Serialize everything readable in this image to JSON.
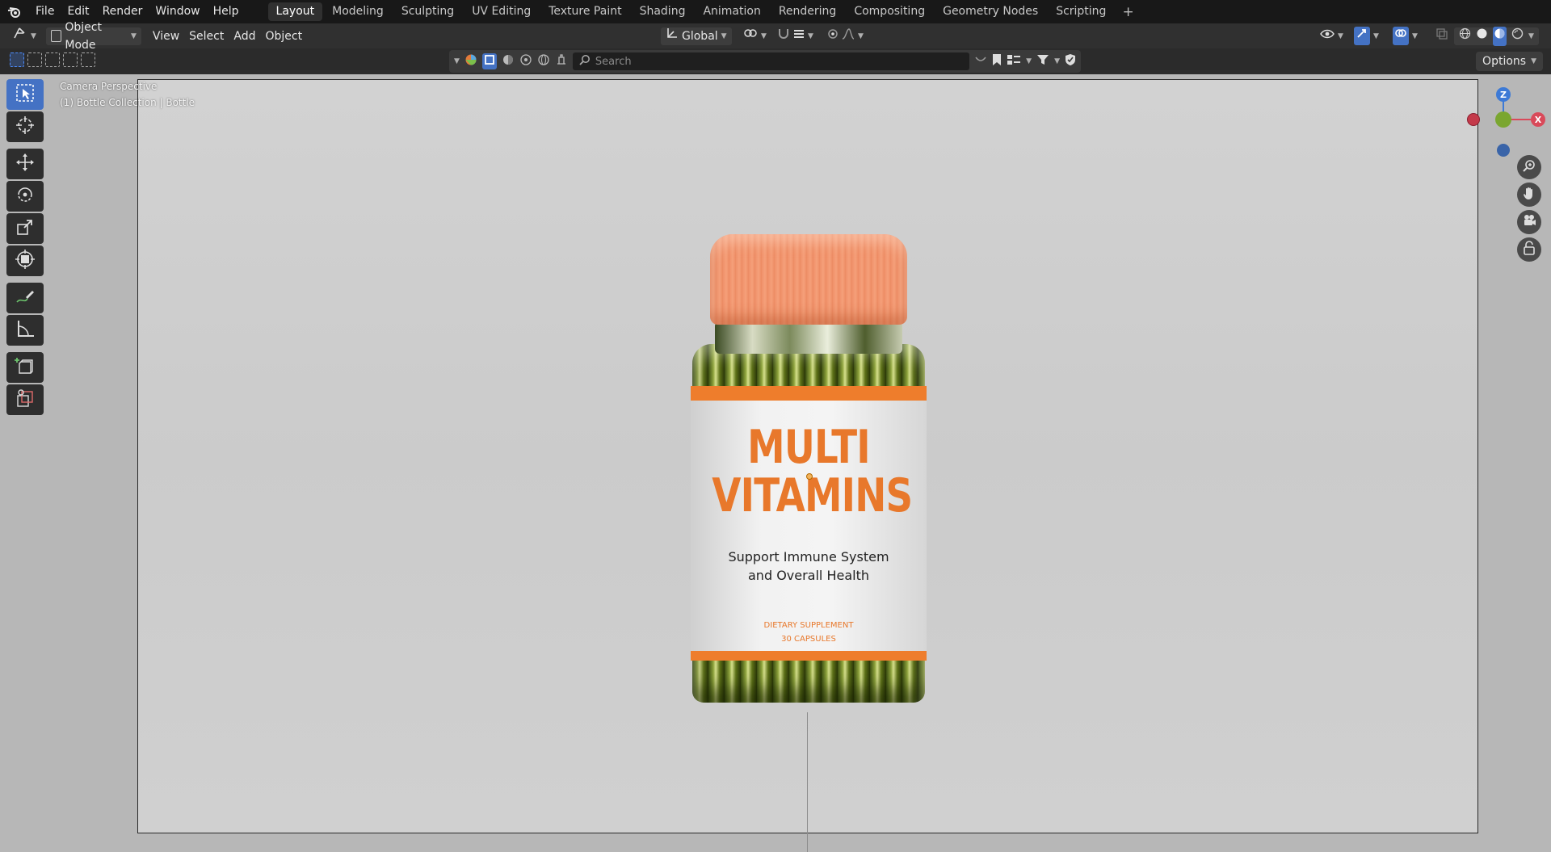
{
  "menu": {
    "file": "File",
    "edit": "Edit",
    "render": "Render",
    "window": "Window",
    "help": "Help"
  },
  "workspaces": [
    "Layout",
    "Modeling",
    "Sculpting",
    "UV Editing",
    "Texture Paint",
    "Shading",
    "Animation",
    "Rendering",
    "Compositing",
    "Geometry Nodes",
    "Scripting"
  ],
  "active_workspace": "Layout",
  "header": {
    "mode": "Object Mode",
    "view": "View",
    "select": "Select",
    "add": "Add",
    "object": "Object",
    "orientation": "Global",
    "options": "Options"
  },
  "search": {
    "placeholder": "Search"
  },
  "viewport": {
    "camera_label": "Camera Perspective",
    "collection_label": "(1) Bottle Collection | Bottle"
  },
  "gizmo": {
    "z": "Z",
    "x": "X"
  },
  "bottle_label": {
    "title_line1": "MULTI",
    "title_line2": "VITAMINS",
    "subtitle_line1": "Support Immune System",
    "subtitle_line2": "and Overall Health",
    "small_line1": "DIETARY SUPPLEMENT",
    "small_line2": "30 CAPSULES"
  },
  "colors": {
    "accent": "#4472c4",
    "cap": "#f0916a",
    "label_orange": "#e8782b"
  },
  "icons": [
    "blender-logo-icon",
    "editor-type-icon",
    "mode-icon",
    "transform-orientation-icon",
    "pivot-icon",
    "snap-icon",
    "proportional-edit-icon",
    "search-icon",
    "filter-icon",
    "select-box-icon",
    "cursor-icon",
    "move-icon",
    "rotate-icon",
    "scale-icon",
    "transform-icon",
    "annotate-icon",
    "measure-icon",
    "add-cube-icon",
    "camera-icon",
    "zoom-icon",
    "hand-icon",
    "lock-icon"
  ]
}
